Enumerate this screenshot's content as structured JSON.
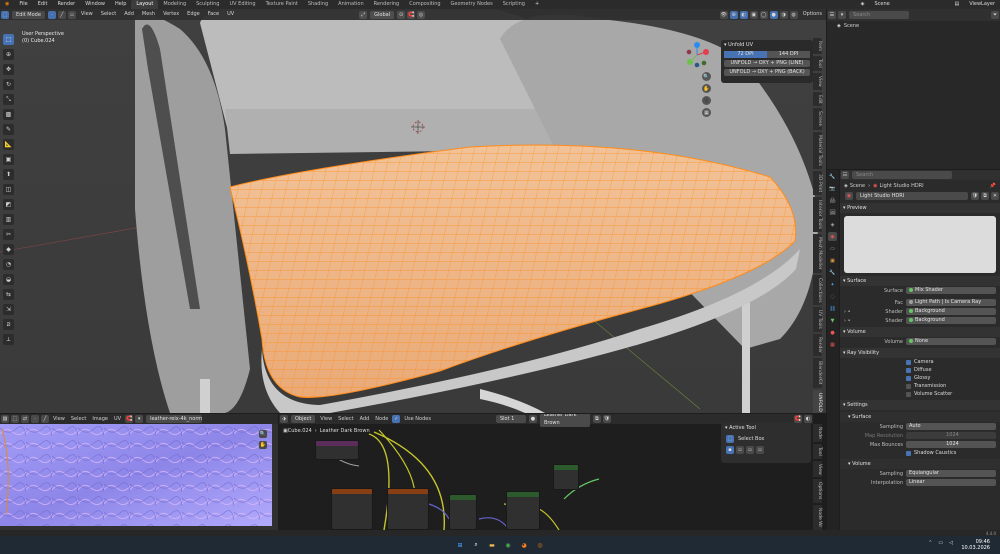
{
  "topbar": {
    "menus": [
      "File",
      "Edit",
      "Render",
      "Window",
      "Help"
    ],
    "workspaces": [
      "Layout",
      "Modeling",
      "Sculpting",
      "UV Editing",
      "Texture Paint",
      "Shading",
      "Animation",
      "Rendering",
      "Compositing",
      "Geometry Nodes",
      "Scripting"
    ],
    "active_workspace": "Layout",
    "scene_label": "Scene",
    "viewlayer_label": "ViewLayer"
  },
  "viewport": {
    "mode": "Edit Mode",
    "menus": [
      "View",
      "Select",
      "Add",
      "Mesh",
      "Vertex",
      "Edge",
      "Face",
      "UV"
    ],
    "transform_orientation": "Global",
    "options_label": "Options",
    "info_line1": "User Perspective",
    "info_line2": "(0) Cube.024"
  },
  "unfold_panel": {
    "title": "Unfold UV",
    "dps_options": [
      "72 DPI",
      "144 DPI"
    ],
    "active_dps": "72 DPI",
    "buttons": [
      "UNFOLD → OXY + PNG (LINE)",
      "UNFOLD → OXY + PNG (BACK)"
    ]
  },
  "viewport_tabs": [
    "Item",
    "Tool",
    "View",
    "Edit",
    "Screen",
    "Material Tools",
    "3D-Print",
    "Interior Tools",
    "Mesh Modeller",
    "Collections",
    "UV Tools",
    "Render",
    "BlenderKit",
    "UNFOLD"
  ],
  "viewport_active_tab": "UNFOLD",
  "image_editor": {
    "menus": [
      "View",
      "Select",
      "Image",
      "UV"
    ],
    "image_name": "leather-reix-4k_normal.jpg"
  },
  "node_editor": {
    "object_type": "Object",
    "menus": [
      "View",
      "Select",
      "Add",
      "Node"
    ],
    "use_nodes_label": "Use Nodes",
    "slot": "Slot 1",
    "material": "Leather Dark Brown",
    "breadcrumb_object": "Cube.024",
    "breadcrumb_material": "Leather Dark Brown"
  },
  "active_tool": {
    "title": "Active Tool",
    "tool": "Select Box"
  },
  "node_tabs": [
    "Node",
    "Tool",
    "View",
    "Options",
    "Node Wr"
  ],
  "outliner": {
    "search_placeholder": "Search",
    "scene_item": "Scene"
  },
  "properties": {
    "search_placeholder": "Search",
    "breadcrumb_scene": "Scene",
    "breadcrumb_world": "Light Studio HDRI",
    "world_name": "Light Studio HDRI",
    "preview_label": "Preview",
    "surface_panel": "Surface",
    "surface_label": "Surface",
    "surface_value": "Mix Shader",
    "fac_label": "Fac",
    "fac_value": "Light Path | Is Camera Ray",
    "shader1_label": "Shader",
    "shader1_value": "Background",
    "shader2_label": "Shader",
    "shader2_value": "Background",
    "volume_panel": "Volume",
    "volume_label": "Volume",
    "volume_value": "None",
    "ray_visibility_panel": "Ray Visibility",
    "rays": [
      {
        "label": "Camera",
        "on": true
      },
      {
        "label": "Diffuse",
        "on": true
      },
      {
        "label": "Glossy",
        "on": true
      },
      {
        "label": "Transmission",
        "on": false
      },
      {
        "label": "Volume Scatter",
        "on": false
      }
    ],
    "settings_panel": "Settings",
    "settings_surface_panel": "Surface",
    "sampling_label": "Sampling",
    "sampling_value": "Auto",
    "map_resolution_label": "Map Resolution",
    "map_resolution_value": "1024",
    "max_bounces_label": "Max Bounces",
    "max_bounces_value": "1024",
    "shadow_caustics_label": "Shadow Caustics",
    "settings_volume_panel": "Volume",
    "vol_sampling_label": "Sampling",
    "vol_sampling_value": "Equiangular",
    "interpolation_label": "Interpolation",
    "interpolation_value": "Linear"
  },
  "status": {
    "version": "4.4.0"
  },
  "clock": {
    "time": "09:46",
    "date": "10.03.2026"
  },
  "colors": {
    "accent": "#4772b3",
    "selection": "#ff8c1a",
    "bg": "#3d3d3d"
  }
}
